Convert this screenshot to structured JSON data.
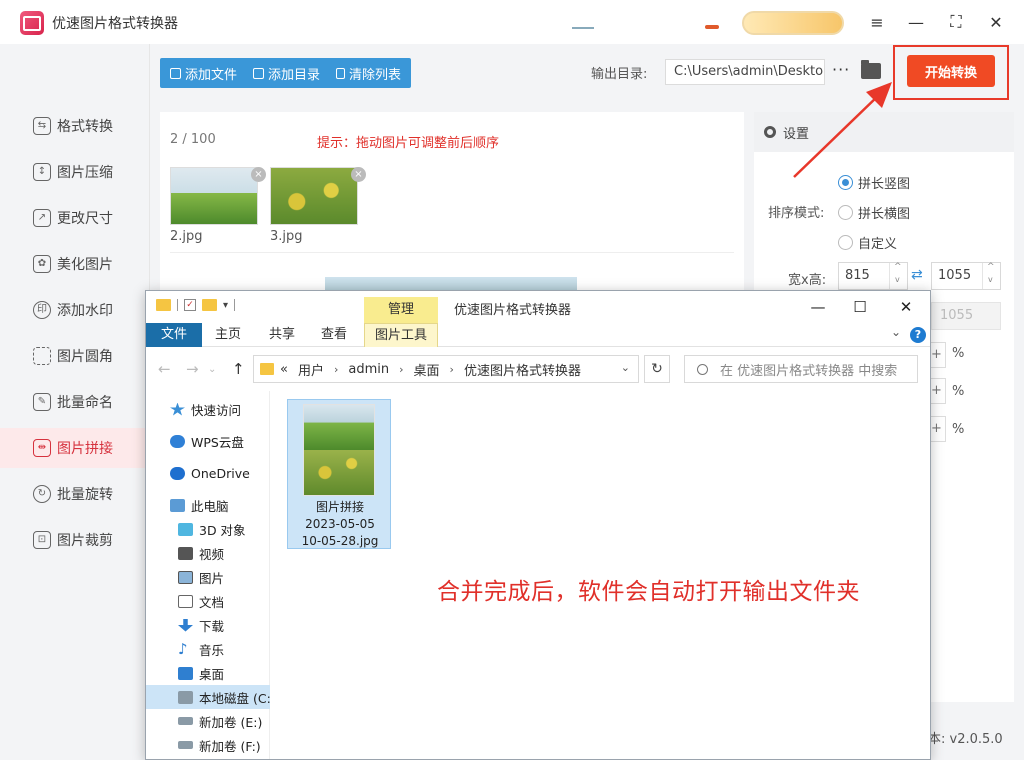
{
  "app": {
    "title": "优速图片格式转换器",
    "window_controls": {
      "menu": "≡",
      "minimize": "—",
      "maximize": "⛶",
      "close": "✕"
    }
  },
  "sidebar": {
    "items": [
      {
        "label": "格式转换",
        "icon": "format-convert-icon",
        "active": false
      },
      {
        "label": "图片压缩",
        "icon": "compress-icon",
        "active": false
      },
      {
        "label": "更改尺寸",
        "icon": "resize-icon",
        "active": false
      },
      {
        "label": "美化图片",
        "icon": "beautify-icon",
        "active": false
      },
      {
        "label": "添加水印",
        "icon": "watermark-icon",
        "active": false
      },
      {
        "label": "图片圆角",
        "icon": "rounded-corner-icon",
        "active": false
      },
      {
        "label": "批量命名",
        "icon": "rename-icon",
        "active": false
      },
      {
        "label": "图片拼接",
        "icon": "stitch-icon",
        "active": true
      },
      {
        "label": "批量旋转",
        "icon": "rotate-icon",
        "active": false
      },
      {
        "label": "图片裁剪",
        "icon": "crop-icon",
        "active": false
      }
    ],
    "active_color": "#d6323e"
  },
  "toolbar": {
    "add_file": "添加文件",
    "add_folder": "添加目录",
    "clear_list": "清除列表",
    "output_label": "输出目录:",
    "output_path": "C:\\Users\\admin\\Deskto",
    "more": "···",
    "start_button": "开始转换",
    "accent": "#3a97d8",
    "start_color": "#f04a24"
  },
  "file_list": {
    "count": "2 / 100",
    "hint": "提示：拖动图片可调整前后顺序",
    "files": [
      {
        "name": "2.jpg",
        "close": "×"
      },
      {
        "name": "3.jpg",
        "close": "×"
      }
    ]
  },
  "settings": {
    "header": "设置",
    "sort_label": "排序模式:",
    "sort_options": [
      {
        "label": "拼长竖图",
        "selected": true
      },
      {
        "label": "拼长横图",
        "selected": false
      },
      {
        "label": "自定义",
        "selected": false
      }
    ],
    "size_label": "宽x高:",
    "width": "815",
    "height": "1055",
    "height_disabled": "1055",
    "percent": "%",
    "version": "本: v2.0.5.0"
  },
  "explorer": {
    "manage_tab": "管理",
    "title": "优速图片格式转换器",
    "ribbon_tabs": [
      "文件",
      "主页",
      "共享",
      "查看",
      "图片工具"
    ],
    "breadcrumb": [
      "«",
      "用户",
      "admin",
      "桌面",
      "优速图片格式转换器"
    ],
    "search_placeholder": "在 优速图片格式转换器 中搜索",
    "tree": [
      {
        "label": "快速访问",
        "icon": "star-icon"
      },
      {
        "label": "WPS云盘",
        "icon": "cloud-icon"
      },
      {
        "label": "OneDrive",
        "icon": "onedrive-icon"
      },
      {
        "label": "此电脑",
        "icon": "pc-icon"
      },
      {
        "label": "3D 对象",
        "icon": "3d-objects-icon"
      },
      {
        "label": "视频",
        "icon": "video-icon"
      },
      {
        "label": "图片",
        "icon": "pictures-icon"
      },
      {
        "label": "文档",
        "icon": "documents-icon"
      },
      {
        "label": "下载",
        "icon": "download-icon"
      },
      {
        "label": "音乐",
        "icon": "music-icon"
      },
      {
        "label": "桌面",
        "icon": "desktop-icon"
      },
      {
        "label": "本地磁盘 (C:)",
        "icon": "drive-icon",
        "selected": true
      },
      {
        "label": "新加卷 (E:)",
        "icon": "drive-icon"
      },
      {
        "label": "新加卷 (F:)",
        "icon": "drive-icon"
      }
    ],
    "file": {
      "name_line1": "图片拼接",
      "name_line2": "2023-05-05",
      "name_line3": "10-05-28.jpg"
    }
  },
  "annotation": "合并完成后，软件会自动打开输出文件夹"
}
